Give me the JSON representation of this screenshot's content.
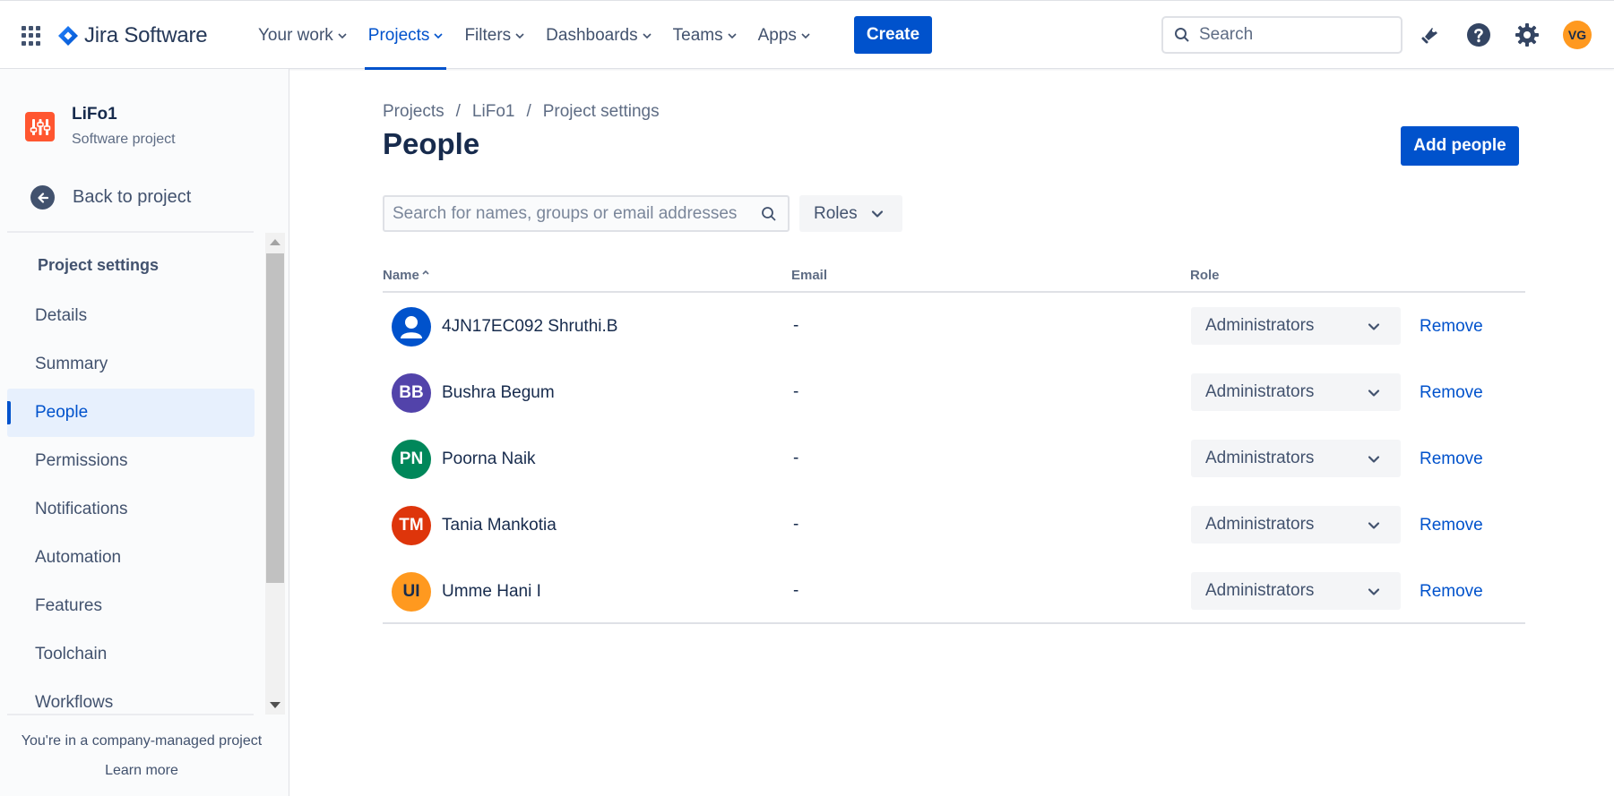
{
  "topnav": {
    "brand": "Jira Software",
    "items": [
      {
        "label": "Your work",
        "active": false
      },
      {
        "label": "Projects",
        "active": true
      },
      {
        "label": "Filters",
        "active": false
      },
      {
        "label": "Dashboards",
        "active": false
      },
      {
        "label": "Teams",
        "active": false
      },
      {
        "label": "Apps",
        "active": false
      }
    ],
    "create_label": "Create",
    "search_placeholder": "Search",
    "avatar_initials": "VG",
    "icons": [
      "app-switcher-icon",
      "notifications-icon",
      "help-icon",
      "settings-icon"
    ]
  },
  "sidebar": {
    "project_name": "LiFo1",
    "project_type": "Software project",
    "back_label": "Back to project",
    "section_title": "Project settings",
    "items": [
      {
        "label": "Details",
        "active": false
      },
      {
        "label": "Summary",
        "active": false
      },
      {
        "label": "People",
        "active": true
      },
      {
        "label": "Permissions",
        "active": false
      },
      {
        "label": "Notifications",
        "active": false
      },
      {
        "label": "Automation",
        "active": false
      },
      {
        "label": "Features",
        "active": false
      },
      {
        "label": "Toolchain",
        "active": false
      },
      {
        "label": "Workflows",
        "active": false
      }
    ],
    "footer_note": "You're in a company-managed project",
    "footer_link": "Learn more"
  },
  "main": {
    "breadcrumb": [
      "Projects",
      "LiFo1",
      "Project settings"
    ],
    "title": "People",
    "add_button": "Add people",
    "search_placeholder": "Search for names, groups or email addresses",
    "roles_filter": "Roles",
    "columns": {
      "name": "Name",
      "email": "Email",
      "role": "Role"
    },
    "remove_label": "Remove",
    "rows": [
      {
        "initials": "",
        "name": "4JN17EC092 Shruthi.B",
        "email": "-",
        "role": "Administrators",
        "avatar_color": "#0052cc",
        "default_avatar": true
      },
      {
        "initials": "BB",
        "name": "Bushra Begum",
        "email": "-",
        "role": "Administrators",
        "avatar_color": "#5243aa",
        "default_avatar": false
      },
      {
        "initials": "PN",
        "name": "Poorna Naik",
        "email": "-",
        "role": "Administrators",
        "avatar_color": "#00875a",
        "default_avatar": false
      },
      {
        "initials": "TM",
        "name": "Tania Mankotia",
        "email": "-",
        "role": "Administrators",
        "avatar_color": "#de350b",
        "default_avatar": false
      },
      {
        "initials": "UI",
        "name": "Umme Hani I",
        "email": "-",
        "role": "Administrators",
        "avatar_color": "#ff991f",
        "default_avatar": false
      }
    ]
  },
  "colors": {
    "primary": "#0052cc",
    "text": "#172b4d",
    "subtle_text": "#42526e",
    "project_icon": "#ff5630"
  }
}
